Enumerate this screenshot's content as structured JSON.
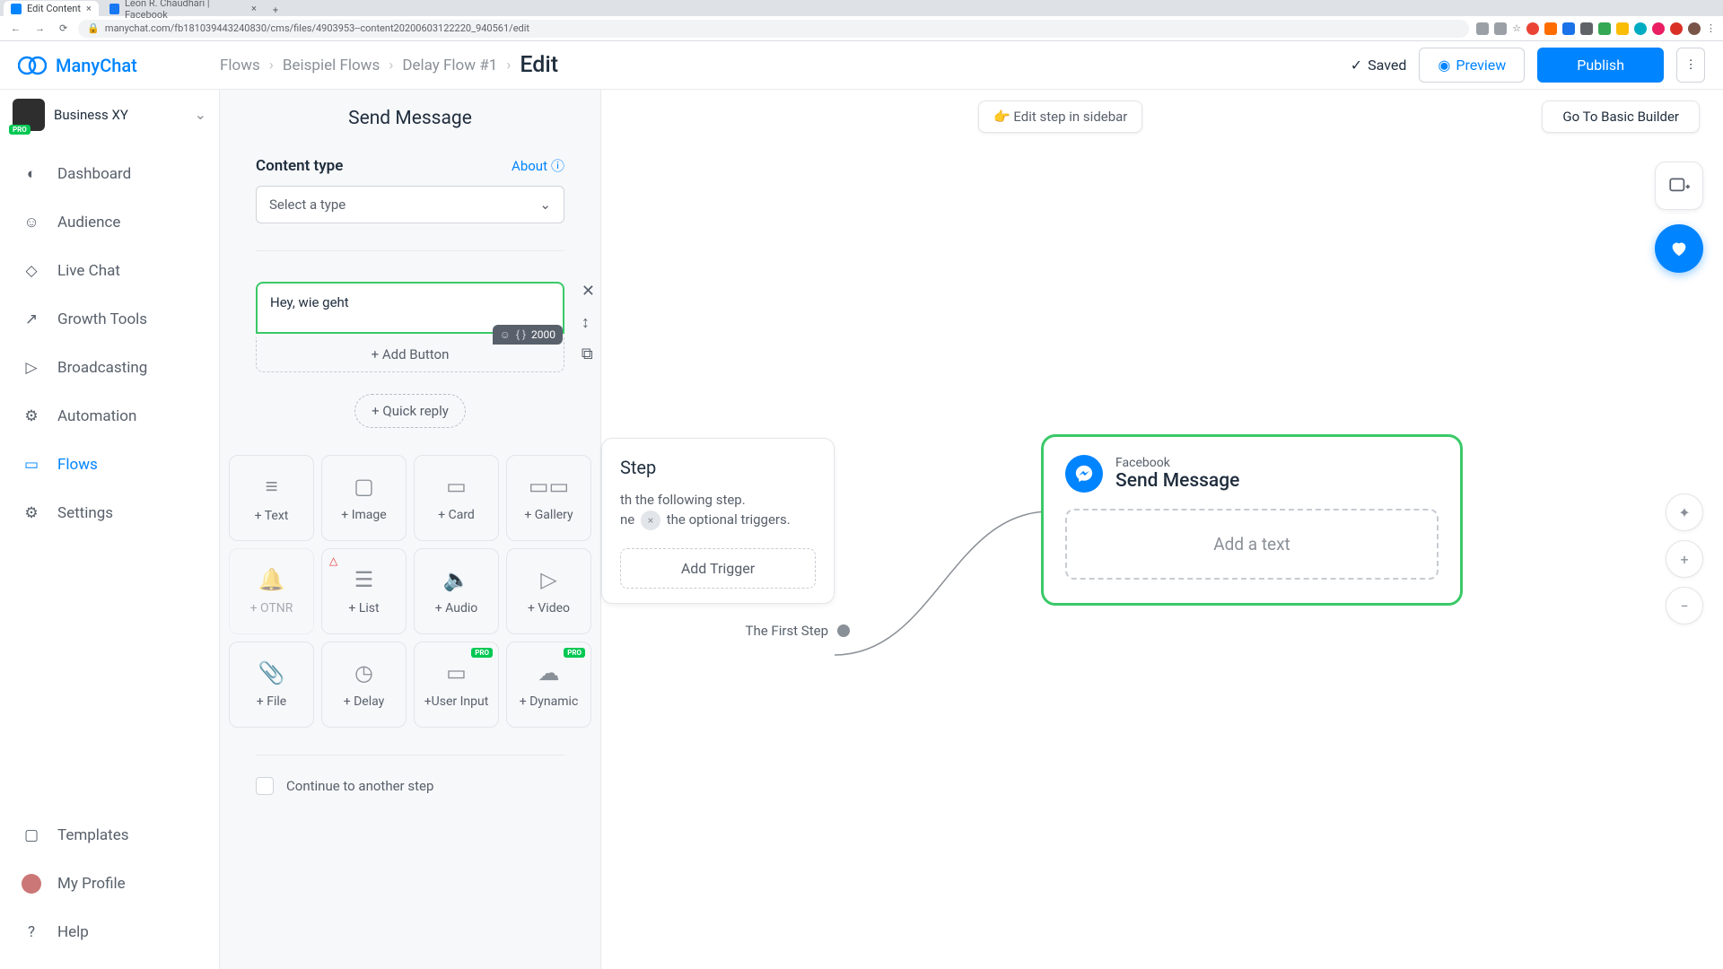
{
  "browser": {
    "tabs": [
      {
        "title": "Edit Content",
        "active": true
      },
      {
        "title": "Leon R. Chaudhari | Facebook",
        "active": false
      }
    ],
    "url": "manychat.com/fb181039443240830/cms/files/4903953--content20200603122220_940561/edit"
  },
  "brand": "ManyChat",
  "breadcrumb": {
    "flows": "Flows",
    "group": "Beispiel Flows",
    "flow": "Delay Flow #1",
    "edit": "Edit"
  },
  "header": {
    "saved": "Saved",
    "preview": "Preview",
    "publish": "Publish"
  },
  "workspace": {
    "name": "Business XY",
    "pro": "PRO"
  },
  "nav": {
    "dashboard": "Dashboard",
    "audience": "Audience",
    "livechat": "Live Chat",
    "growth": "Growth Tools",
    "broadcasting": "Broadcasting",
    "automation": "Automation",
    "flows": "Flows",
    "settings": "Settings",
    "templates": "Templates",
    "profile": "My Profile",
    "help": "Help"
  },
  "panel": {
    "title": "Send Message",
    "content_type_label": "Content type",
    "about": "About",
    "select_placeholder": "Select a type",
    "message_text": "Hey, wie geht",
    "char_limit": "2000",
    "add_button": "+ Add Button",
    "quick_reply": "+ Quick reply",
    "continue": "Continue to another step"
  },
  "content_types": {
    "text": "+ Text",
    "image": "+ Image",
    "card": "+ Card",
    "gallery": "+ Gallery",
    "otnr": "+ OTNR",
    "list": "+ List",
    "audio": "+ Audio",
    "video": "+ Video",
    "file": "+ File",
    "delay": "+ Delay",
    "userinput": "+User Input",
    "dynamic": "+ Dynamic"
  },
  "canvas": {
    "edit_sidebar": "Edit step in sidebar",
    "basic_builder": "Go To Basic Builder",
    "start": {
      "title": "Step",
      "line1": "th the following step.",
      "line2": "ne",
      "line3": "the optional triggers.",
      "add_trigger": "Add Trigger",
      "first_step": "The First Step"
    },
    "node": {
      "platform": "Facebook",
      "action": "Send Message",
      "add_text": "Add a text"
    }
  },
  "colors": {
    "primary": "#0084ff",
    "success": "#3ac968",
    "pro": "#00c853"
  }
}
